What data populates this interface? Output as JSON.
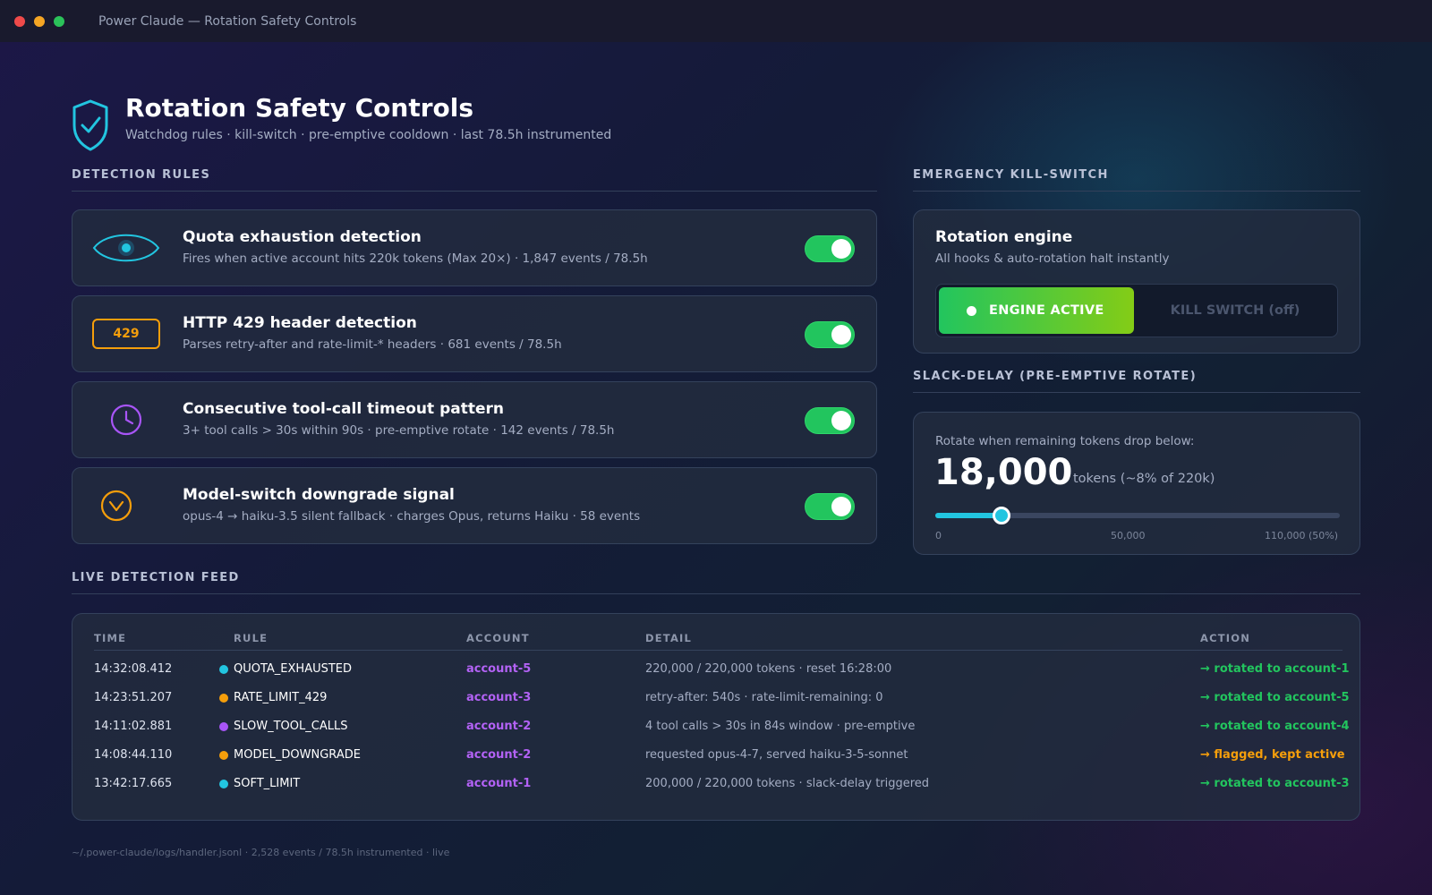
{
  "window": {
    "title": "Power Claude — Rotation Safety Controls"
  },
  "header": {
    "title": "Rotation Safety Controls",
    "subtitle": "Watchdog rules · kill-switch · pre-emptive cooldown · last 78.5h instrumented",
    "icon": "shield-check-icon"
  },
  "sections": {
    "detection_rules": "DETECTION RULES",
    "kill_switch": "EMERGENCY KILL-SWITCH",
    "slack_delay": "SLACK-DELAY (PRE-EMPTIVE ROTATE)",
    "live_feed": "LIVE DETECTION FEED"
  },
  "rules": [
    {
      "name": "Quota exhaustion detection",
      "desc": "Fires when active account hits 220k tokens (Max 20×) · 1,847 events / 78.5h",
      "icon": "eye-icon",
      "enabled": true
    },
    {
      "name": "HTTP 429 header detection",
      "desc": "Parses retry-after and rate-limit-* headers · 681 events / 78.5h",
      "icon": "status-code-badge",
      "badge": "429",
      "enabled": true
    },
    {
      "name": "Consecutive tool-call timeout pattern",
      "desc": "3+ tool calls > 30s within 90s · pre-emptive rotate · 142 events / 78.5h",
      "icon": "clock-icon",
      "enabled": true
    },
    {
      "name": "Model-switch downgrade signal",
      "desc": "opus-4 → haiku-3.5 silent fallback · charges Opus, returns Haiku · 58 events",
      "icon": "chevron-down-circle-icon",
      "enabled": true
    }
  ],
  "kill_switch": {
    "title": "Rotation engine",
    "subtitle": "All hooks & auto-rotation halt instantly",
    "active_label": "ENGINE ACTIVE",
    "off_label": "KILL SWITCH (off)",
    "state": "active"
  },
  "slack": {
    "label": "Rotate when remaining tokens drop below:",
    "value": "18,000",
    "unit": "tokens (~8% of 220k)",
    "slider_value": 18000,
    "slider_min": 0,
    "slider_max": 110000,
    "ticks": [
      "0",
      "50,000",
      "110,000 (50%)"
    ]
  },
  "feed": {
    "columns": [
      "TIME",
      "RULE",
      "ACCOUNT",
      "DETAIL",
      "ACTION"
    ],
    "rows": [
      {
        "time": "14:32:08.412",
        "rule": "QUOTA_EXHAUSTED",
        "dot": "#22c5e0",
        "account": "account-5",
        "detail": "220,000 / 220,000 tokens · reset 16:28:00",
        "action": "→ rotated to account-1",
        "action_color": "#22c55e"
      },
      {
        "time": "14:23:51.207",
        "rule": "RATE_LIMIT_429",
        "dot": "#f59e0b",
        "account": "account-3",
        "detail": "retry-after: 540s · rate-limit-remaining: 0",
        "action": "→ rotated to account-5",
        "action_color": "#22c55e"
      },
      {
        "time": "14:11:02.881",
        "rule": "SLOW_TOOL_CALLS",
        "dot": "#a855f7",
        "account": "account-2",
        "detail": "4 tool calls > 30s in 84s window · pre-emptive",
        "action": "→ rotated to account-4",
        "action_color": "#22c55e"
      },
      {
        "time": "14:08:44.110",
        "rule": "MODEL_DOWNGRADE",
        "dot": "#f59e0b",
        "account": "account-2",
        "detail": "requested opus-4-7, served haiku-3-5-sonnet",
        "action": "→ flagged, kept active",
        "action_color": "#f59e0b"
      },
      {
        "time": "13:42:17.665",
        "rule": "SOFT_LIMIT",
        "dot": "#22c5e0",
        "account": "account-1",
        "detail": "200,000 / 220,000 tokens · slack-delay triggered",
        "action": "→ rotated to account-3",
        "action_color": "#22c55e"
      }
    ]
  },
  "footer": "~/.power-claude/logs/handler.jsonl · 2,528 events / 78.5h instrumented · live",
  "colors": {
    "accent_cyan": "#22c5e0",
    "toggle_on": "#22c55e",
    "account_purple": "#b362f5",
    "warn": "#f59e0b"
  }
}
